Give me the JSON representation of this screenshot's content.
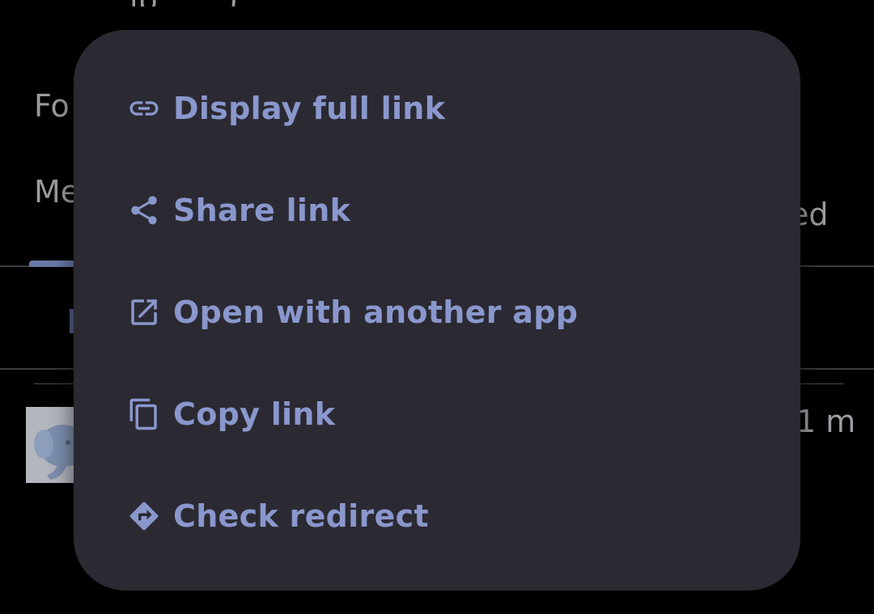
{
  "background": {
    "top_cut_text": "ip    . . .   )",
    "row1_text": "Fo",
    "row2_text": "Me",
    "row2_right_text": "ed",
    "row3_right_text": "1 m"
  },
  "menu": {
    "items": [
      {
        "label": "Display full link",
        "icon": "link-icon"
      },
      {
        "label": "Share link",
        "icon": "share-icon"
      },
      {
        "label": "Open with another app",
        "icon": "open-external-icon"
      },
      {
        "label": "Copy link",
        "icon": "copy-icon"
      },
      {
        "label": "Check redirect",
        "icon": "directions-icon"
      }
    ]
  },
  "colors": {
    "menu_background": "#2b2a32",
    "menu_text": "#8a97cd",
    "screen_background": "#000000"
  }
}
